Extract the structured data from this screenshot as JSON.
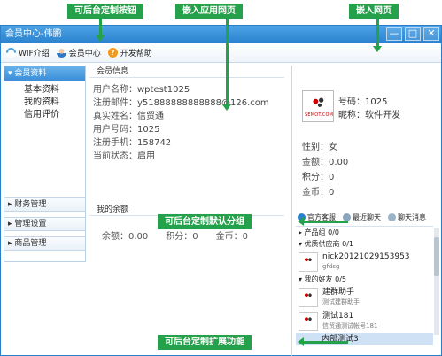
{
  "annotations": {
    "custom_buttons": "可后台定制按钮",
    "embed_app": "嵌入应用网页",
    "embed_web": "嵌入网页",
    "default_group": "可后台定制默认分组",
    "extend_func": "可后台定制扩展功能"
  },
  "window": {
    "title": "会员中心-伟鹏",
    "min": "—",
    "max": "□",
    "close": "✕"
  },
  "toolbar": {
    "items": [
      {
        "label": "WIF介绍",
        "icon": "wifi-icon"
      },
      {
        "label": "会员中心",
        "icon": "user-icon"
      },
      {
        "label": "开发帮助",
        "icon": "help-icon"
      }
    ]
  },
  "sidebar": {
    "header": "会员资料",
    "subitems": [
      "基本资料",
      "我的资料",
      "信用评价"
    ],
    "groups": [
      "财务管理",
      "管理设置",
      "商品管理"
    ]
  },
  "member_info": {
    "title": "会员信息",
    "rows": [
      {
        "k": "用户名称：",
        "v": "wptest1025"
      },
      {
        "k": "注册邮件：",
        "v": "y51888888888888@126.com"
      },
      {
        "k": "真实姓名：",
        "v": "信贸通"
      },
      {
        "k": "用户号码：",
        "v": "1025"
      },
      {
        "k": "注册手机：",
        "v": "158742"
      },
      {
        "k": "当前状态：",
        "v": "启用"
      }
    ]
  },
  "balance": {
    "title": "我的余额",
    "items": [
      "余额：0.00",
      "积分：0",
      "金币：0"
    ]
  },
  "profile": {
    "logo_text": "SEMOT.COM",
    "id_label": "号码：1025",
    "nick_label": "昵称：软件开发",
    "stats": [
      "性别：女",
      "金额：0.00",
      "积分：0",
      "金币：0"
    ]
  },
  "tabs": [
    "官方客服",
    "最近聊天",
    "聊天消息"
  ],
  "contacts": {
    "groups": [
      {
        "label": "▸ 产品组 0/0"
      },
      {
        "label": "▾ 优质供应商 0/1"
      },
      {
        "label": "▾ 我的好友 0/5"
      }
    ],
    "items": [
      {
        "name": "nick20121029153953",
        "sub": "gfdsg"
      },
      {
        "name": "建群助手",
        "sub": "测试建群助手"
      },
      {
        "name": "测试181",
        "sub": "信贸通测试帐号181"
      },
      {
        "name": "内部测试3",
        "sub": ""
      }
    ]
  },
  "colors": {
    "accent": "#2a82cf",
    "annotation": "#24a14a"
  }
}
